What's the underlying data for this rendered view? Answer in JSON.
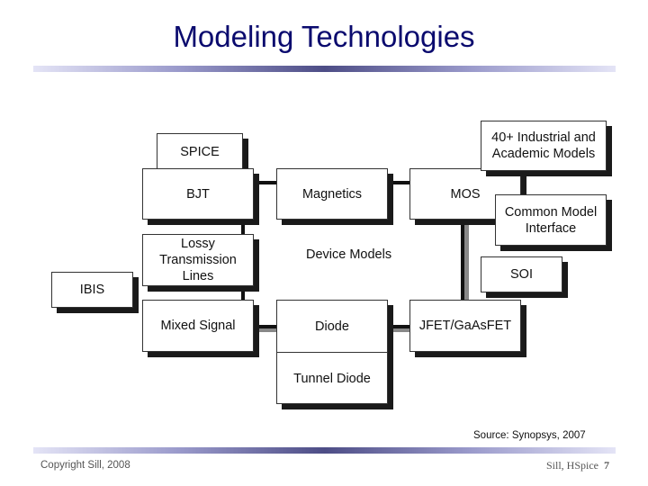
{
  "slide": {
    "title": "Modeling Technologies",
    "source": "Source: Synopsys, 2007",
    "footer": {
      "copyright": "Copyright Sill, 2008",
      "right_label": "Sill, HSpice",
      "page_number": "7"
    }
  },
  "diagram": {
    "center_label": "Device Models",
    "boxes": {
      "spice": "SPICE",
      "bjt": "BJT",
      "magnetics": "Magnetics",
      "mos": "MOS",
      "industrial": "40+ Industrial and Academic Models",
      "cmi": "Common Model Interface",
      "soi": "SOI",
      "lossy": "Lossy Transmission Lines",
      "ibis": "IBIS",
      "mixed_signal": "Mixed Signal",
      "diode": "Diode",
      "tunnel_diode": "Tunnel Diode",
      "jfet": "JFET/GaAsFET"
    }
  }
}
